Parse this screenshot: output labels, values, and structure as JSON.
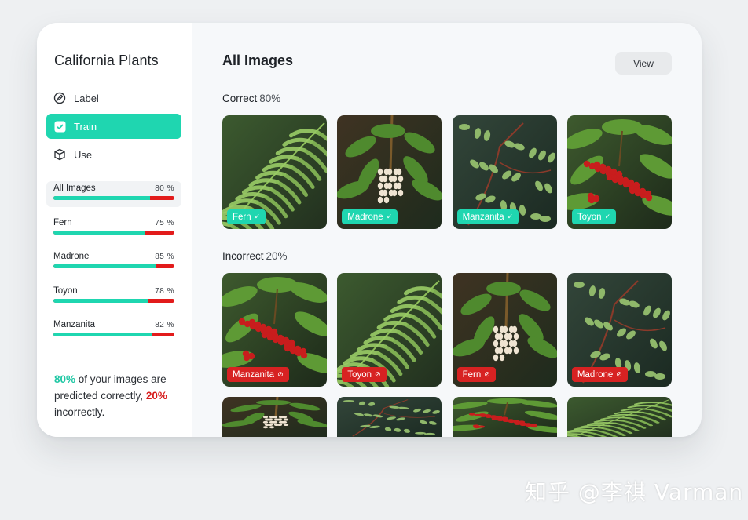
{
  "sidebar": {
    "title": "California Plants",
    "nav": [
      {
        "label": "Label",
        "icon": "edit-icon",
        "active": false
      },
      {
        "label": "Train",
        "icon": "checkbox-icon",
        "active": true
      },
      {
        "label": "Use",
        "icon": "cube-icon",
        "active": false
      }
    ],
    "stats": [
      {
        "label": "All Images",
        "pct": "80 %",
        "value": 0.8,
        "active": true
      },
      {
        "label": "Fern",
        "pct": "75 %",
        "value": 0.75,
        "active": false
      },
      {
        "label": "Madrone",
        "pct": "85 %",
        "value": 0.85,
        "active": false
      },
      {
        "label": "Toyon",
        "pct": "78 %",
        "value": 0.78,
        "active": false
      },
      {
        "label": "Manzanita",
        "pct": "82 %",
        "value": 0.82,
        "active": false
      }
    ],
    "summary": {
      "correct_pct": "80%",
      "text1": " of your images are predicted correctly,",
      "incorrect_pct": "20%",
      "text2": " incorrectly."
    }
  },
  "main": {
    "title": "All Images",
    "view_button": "View",
    "correct": {
      "label": "Correct",
      "pct": "80%",
      "tiles": [
        {
          "tag": "Fern",
          "kind": "fern"
        },
        {
          "tag": "Madrone",
          "kind": "madrone"
        },
        {
          "tag": "Manzanita",
          "kind": "manzanita"
        },
        {
          "tag": "Toyon",
          "kind": "toyon"
        }
      ]
    },
    "incorrect": {
      "label": "Incorrect",
      "pct": "20%",
      "tiles": [
        {
          "tag": "Manzanita",
          "kind": "toyon"
        },
        {
          "tag": "Toyon",
          "kind": "fern"
        },
        {
          "tag": "Fern",
          "kind": "madrone"
        },
        {
          "tag": "Madrone",
          "kind": "manzanita"
        }
      ]
    },
    "more_tiles": [
      {
        "kind": "madrone"
      },
      {
        "kind": "manzanita"
      },
      {
        "kind": "toyon"
      },
      {
        "kind": "fern"
      }
    ]
  },
  "colors": {
    "accent": "#1fd6b0",
    "error": "#d72222",
    "leaf": "#5f9a3a",
    "berry": "#c21a1a"
  },
  "watermark": "知乎 @李祺 Varman"
}
